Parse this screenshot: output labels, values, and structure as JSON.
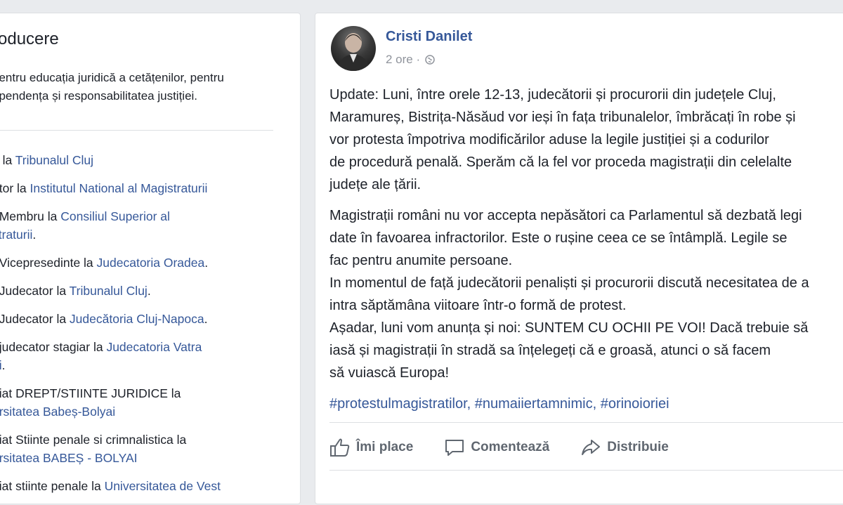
{
  "intro": {
    "title": "roducere",
    "bio_lines": [
      "pentru educația juridică a cetățenilor, pentru",
      "ependența și responsabilitatea justiției."
    ],
    "items": [
      {
        "lines": [
          [
            {
              "t": "e la ",
              "l": false
            },
            {
              "t": "Tribunalul Cluj",
              "l": true
            }
          ]
        ]
      },
      {
        "lines": [
          [
            {
              "t": "ator la ",
              "l": false
            },
            {
              "t": "Institutul National al Magistraturii",
              "l": true
            }
          ]
        ]
      },
      {
        "lines": [
          [
            {
              "t": "t Membru la ",
              "l": false
            },
            {
              "t": "Consiliul Superior al",
              "l": true
            }
          ],
          [
            {
              "t": "straturii",
              "l": true
            },
            {
              "t": ".",
              "l": false
            }
          ]
        ]
      },
      {
        "lines": [
          [
            {
              "t": "t Vicepresedinte la ",
              "l": false
            },
            {
              "t": "Judecatoria Oradea",
              "l": true
            },
            {
              "t": ".",
              "l": false
            }
          ]
        ]
      },
      {
        "lines": [
          [
            {
              "t": "t Judecator la ",
              "l": false
            },
            {
              "t": "Tribunalul Cluj",
              "l": true
            },
            {
              "t": ".",
              "l": false
            }
          ]
        ]
      },
      {
        "lines": [
          [
            {
              "t": "t Judecator la ",
              "l": false
            },
            {
              "t": "Judecătoria Cluj-Napoca",
              "l": true
            },
            {
              "t": ".",
              "l": false
            }
          ]
        ]
      },
      {
        "lines": [
          [
            {
              "t": "t judecator stagiar la ",
              "l": false
            },
            {
              "t": "Judecatoria Vatra",
              "l": true
            }
          ],
          [
            {
              "t": "ei",
              "l": true
            },
            {
              "t": ".",
              "l": false
            }
          ]
        ]
      },
      {
        "lines": [
          [
            {
              "t": "diat DREPT/STIINTE JURIDICE la",
              "l": false
            }
          ],
          [
            {
              "t": "ersitatea Babeș-Bolyai",
              "l": true
            }
          ]
        ]
      },
      {
        "lines": [
          [
            {
              "t": "diat Stiinte penale si crimnalistica la",
              "l": false
            }
          ],
          [
            {
              "t": "ersitatea BABEȘ - BOLYAI",
              "l": true
            }
          ]
        ]
      },
      {
        "lines": [
          [
            {
              "t": "diat stiinte penale la ",
              "l": false
            },
            {
              "t": "Universitatea de Vest",
              "l": true
            }
          ]
        ]
      }
    ]
  },
  "post": {
    "author": "Cristi Danilet",
    "time": "2 ore",
    "separator": "·",
    "privacy_icon": "globe-icon",
    "paragraphs": [
      [
        "Update: Luni, între orele 12-13, judecătorii și procurorii din județele Cluj,",
        "Maramureș, Bistrița-Năsăud vor ieși în fața tribunalelor, îmbrăcați în robe și",
        "vor protesta împotriva modificărilor aduse la legile justiției și a codurilor",
        "de procedură penală. Sperăm că la fel vor proceda magistrații din celelalte",
        "județe ale țării."
      ],
      [
        "Magistrații români nu vor accepta nepăsători ca Parlamentul să dezbată legi",
        "date în favoarea infractorilor. Este o rușine ceea ce se întâmplă. Legile se",
        "fac pentru anumite persoane.",
        "In momentul de față judecătorii penaliști și procurorii discută necesitatea de a",
        "intra săptămâna viitoare într-o formă de protest.",
        "Așadar, luni vom anunța și noi: SUNTEM CU OCHII PE VOI! Dacă trebuie să",
        "iasă și magistrații în stradă sa înțelegeți că e groasă, atunci o să facem",
        "să vuiască Europa!"
      ]
    ],
    "hashtags": "#protestulmagistratilor, #numaiiertamnimic, #orinoioriei",
    "actions": {
      "like": "Îmi place",
      "comment": "Comentează",
      "share": "Distribuie"
    }
  },
  "colors": {
    "link": "#365899",
    "text": "#1d2129",
    "meta": "#90949c",
    "background": "#e9ebee"
  }
}
